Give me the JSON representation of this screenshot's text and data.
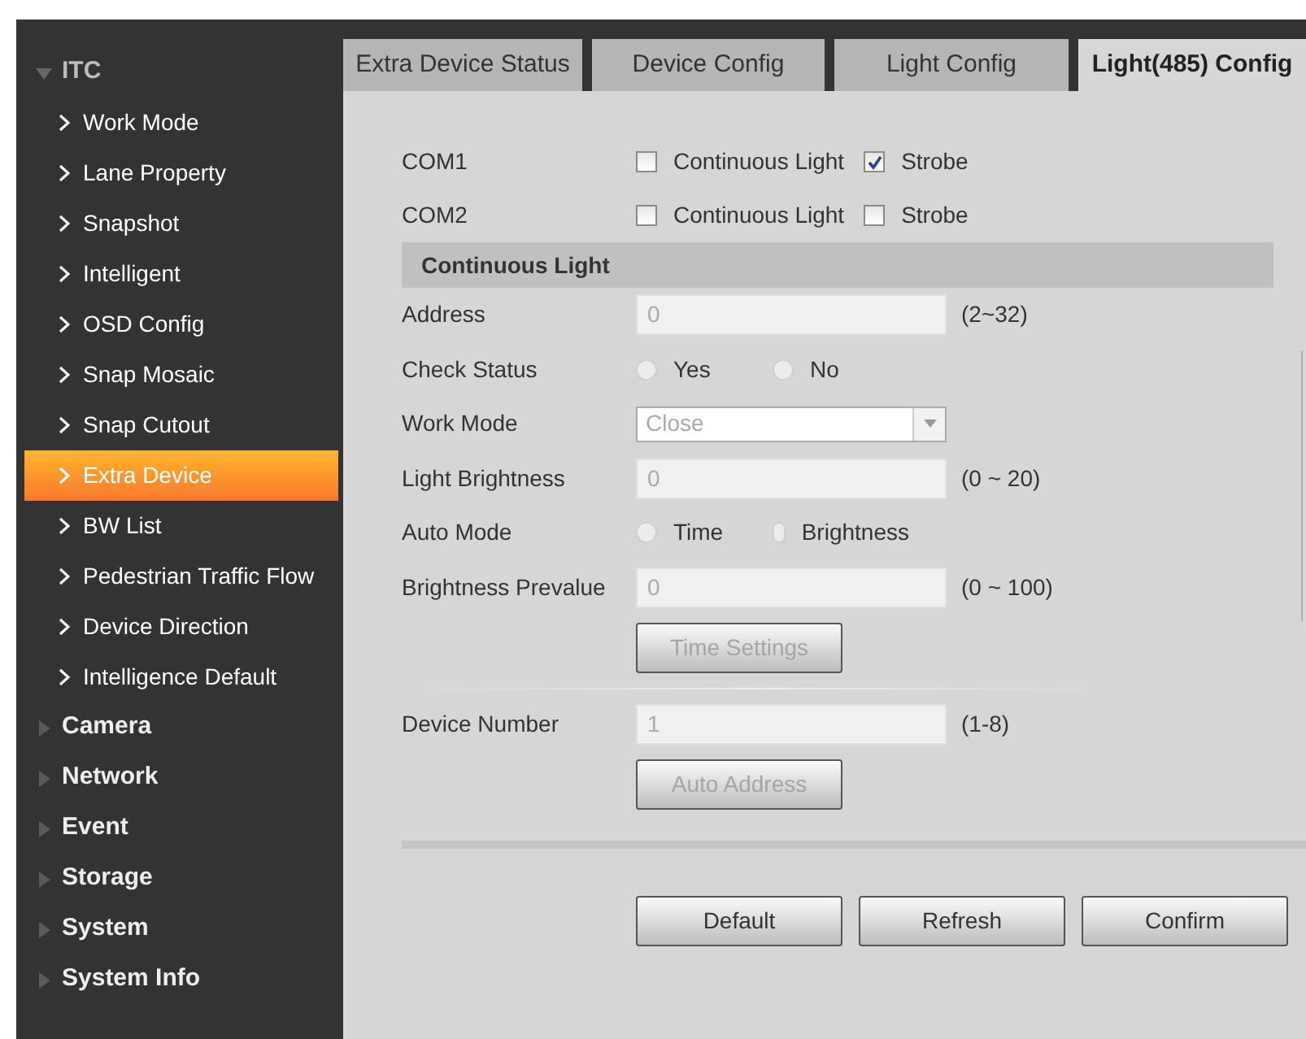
{
  "sidebar": {
    "groups": [
      {
        "label": "ITC",
        "expanded": true,
        "children": [
          {
            "label": "Work Mode",
            "selected": false
          },
          {
            "label": "Lane Property",
            "selected": false
          },
          {
            "label": "Snapshot",
            "selected": false
          },
          {
            "label": "Intelligent",
            "selected": false
          },
          {
            "label": "OSD Config",
            "selected": false
          },
          {
            "label": "Snap Mosaic",
            "selected": false
          },
          {
            "label": "Snap Cutout",
            "selected": false
          },
          {
            "label": "Extra Device",
            "selected": true
          },
          {
            "label": "BW List",
            "selected": false
          },
          {
            "label": "Pedestrian Traffic Flow",
            "selected": false
          },
          {
            "label": "Device Direction",
            "selected": false
          },
          {
            "label": "Intelligence Default",
            "selected": false
          }
        ]
      },
      {
        "label": "Camera",
        "expanded": false
      },
      {
        "label": "Network",
        "expanded": false
      },
      {
        "label": "Event",
        "expanded": false
      },
      {
        "label": "Storage",
        "expanded": false
      },
      {
        "label": "System",
        "expanded": false
      },
      {
        "label": "System Info",
        "expanded": false
      }
    ]
  },
  "tabs": [
    {
      "label": "Extra Device Status",
      "selected": false
    },
    {
      "label": "Device Config",
      "selected": false
    },
    {
      "label": "Light Config",
      "selected": false
    },
    {
      "label": "Light(485) Config",
      "selected": true
    }
  ],
  "com_ports": [
    {
      "label": "COM1",
      "options": [
        {
          "label": "Continuous Light",
          "checked": false
        },
        {
          "label": "Strobe",
          "checked": true
        }
      ]
    },
    {
      "label": "COM2",
      "options": [
        {
          "label": "Continuous Light",
          "checked": false
        },
        {
          "label": "Strobe",
          "checked": false
        }
      ]
    }
  ],
  "section_title": "Continuous Light",
  "rows": [
    {
      "kind": "input",
      "label": "Address",
      "value": "0",
      "range": "(2~32)",
      "disabled": true
    },
    {
      "kind": "radio",
      "label": "Check Status",
      "options": [
        {
          "label": "Yes",
          "selected": false
        },
        {
          "label": "No",
          "selected": false
        }
      ],
      "disabled": true
    },
    {
      "kind": "select",
      "label": "Work Mode",
      "value": "Close",
      "disabled": true
    },
    {
      "kind": "input",
      "label": "Light Brightness",
      "value": "0",
      "range": "(0 ~ 20)",
      "disabled": true
    },
    {
      "kind": "radio",
      "label": "Auto Mode",
      "options": [
        {
          "label": "Time",
          "selected": false
        },
        {
          "label": "Brightness",
          "selected": false
        }
      ],
      "disabled": true
    },
    {
      "kind": "input",
      "label": "Brightness Prevalue",
      "value": "0",
      "range": "(0 ~ 100)",
      "disabled": true
    },
    {
      "kind": "button",
      "label": "Time Settings",
      "disabled": true
    },
    {
      "kind": "divider"
    },
    {
      "kind": "input",
      "label": "Device Number",
      "value": "1",
      "range": "(1-8)",
      "disabled": true
    },
    {
      "kind": "button",
      "label": "Auto Address",
      "disabled": true
    }
  ],
  "buttons": [
    {
      "label": "Default",
      "disabled": false
    },
    {
      "label": "Refresh",
      "disabled": false
    },
    {
      "label": "Confirm",
      "disabled": false
    }
  ]
}
